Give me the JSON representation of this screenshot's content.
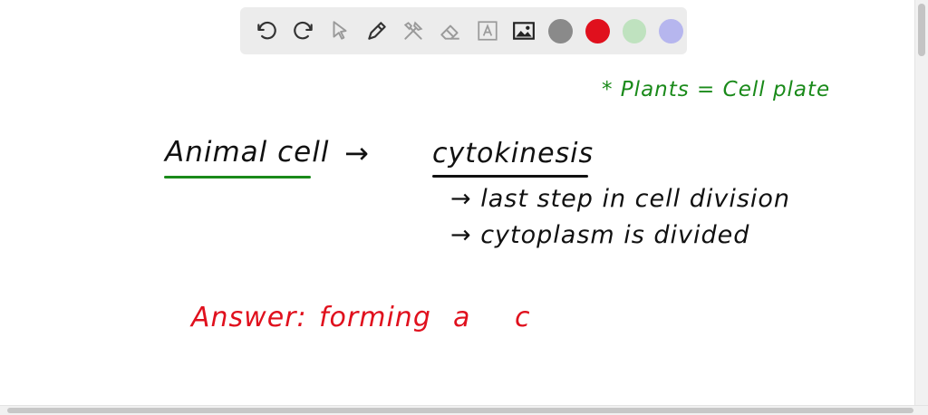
{
  "toolbar": {
    "tools": [
      "undo-icon",
      "redo-icon",
      "select-pointer-icon",
      "pen-icon",
      "tools-icon",
      "eraser-icon",
      "text-box-icon",
      "image-icon"
    ],
    "colors": [
      "#8a8a8a",
      "#e0101d",
      "#bfe2bf",
      "#b6b6ee"
    ]
  },
  "notes": {
    "plants_note": "* Plants = Cell plate",
    "animal_cell": "Animal cell",
    "arrow": "→",
    "cytokinesis": "cytokinesis",
    "bullet1": "→ last step in cell division",
    "bullet2": "→ cytoplasm is divided",
    "answer_label": "Answer:",
    "answer_word1": "forming",
    "answer_word2": "a",
    "answer_word3": "c"
  }
}
